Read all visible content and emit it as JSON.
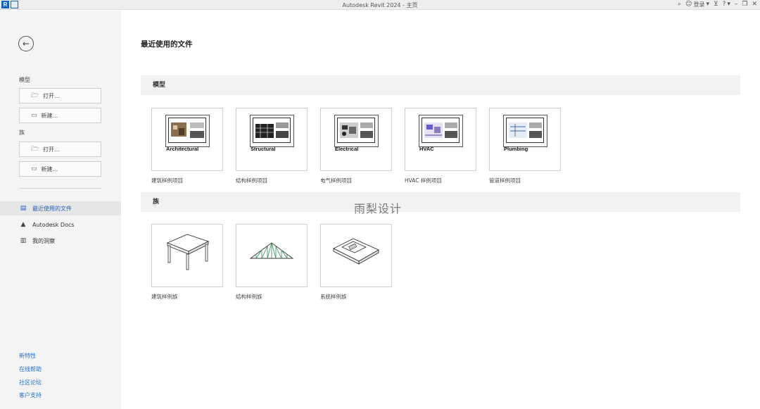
{
  "window": {
    "title": "Autodesk Revit 2024 - 主页",
    "app_logo": "R",
    "user_label": "登录",
    "icons": [
      "binoculars-icon",
      "user-icon",
      "cart-icon",
      "help-icon",
      "minimize-icon",
      "restore-icon",
      "close-icon"
    ]
  },
  "sidebar": {
    "back_icon": "←",
    "models_label": "模型",
    "models_open": "打开...",
    "models_new": "新建...",
    "families_label": "族",
    "families_open": "打开...",
    "families_new": "新建...",
    "nav": [
      {
        "label": "最近使用的文件",
        "icon": "recent-files-icon",
        "active": true
      },
      {
        "label": "Autodesk Docs",
        "icon": "autodesk-logo-icon",
        "active": false
      },
      {
        "label": "我的洞察",
        "icon": "insights-icon",
        "active": false
      }
    ],
    "links": [
      "新特性",
      "在线帮助",
      "社区论坛",
      "客户支持"
    ]
  },
  "main": {
    "title": "最近使用的文件",
    "models_header": "模型",
    "families_header": "族",
    "models": [
      {
        "caption": "Architectural",
        "label": "建筑样例项目"
      },
      {
        "caption": "Structural",
        "label": "结构样例项目"
      },
      {
        "caption": "Electrical",
        "label": "电气样例项目"
      },
      {
        "caption": "HVAC",
        "label": "HVAC 样例项目"
      },
      {
        "caption": "Plumbing",
        "label": "管道样例项目"
      }
    ],
    "families": [
      {
        "label": "建筑样例族",
        "icon": "table-model-icon"
      },
      {
        "label": "结构样例族",
        "icon": "truss-model-icon"
      },
      {
        "label": "系统样例族",
        "icon": "duct-model-icon"
      }
    ],
    "watermark": "雨梨设计"
  },
  "colors": {
    "accent": "#1f5fbf",
    "link": "#2a6fc9",
    "sidebar_bg": "#f4f4f4",
    "section_bg": "#f2f2f2"
  }
}
